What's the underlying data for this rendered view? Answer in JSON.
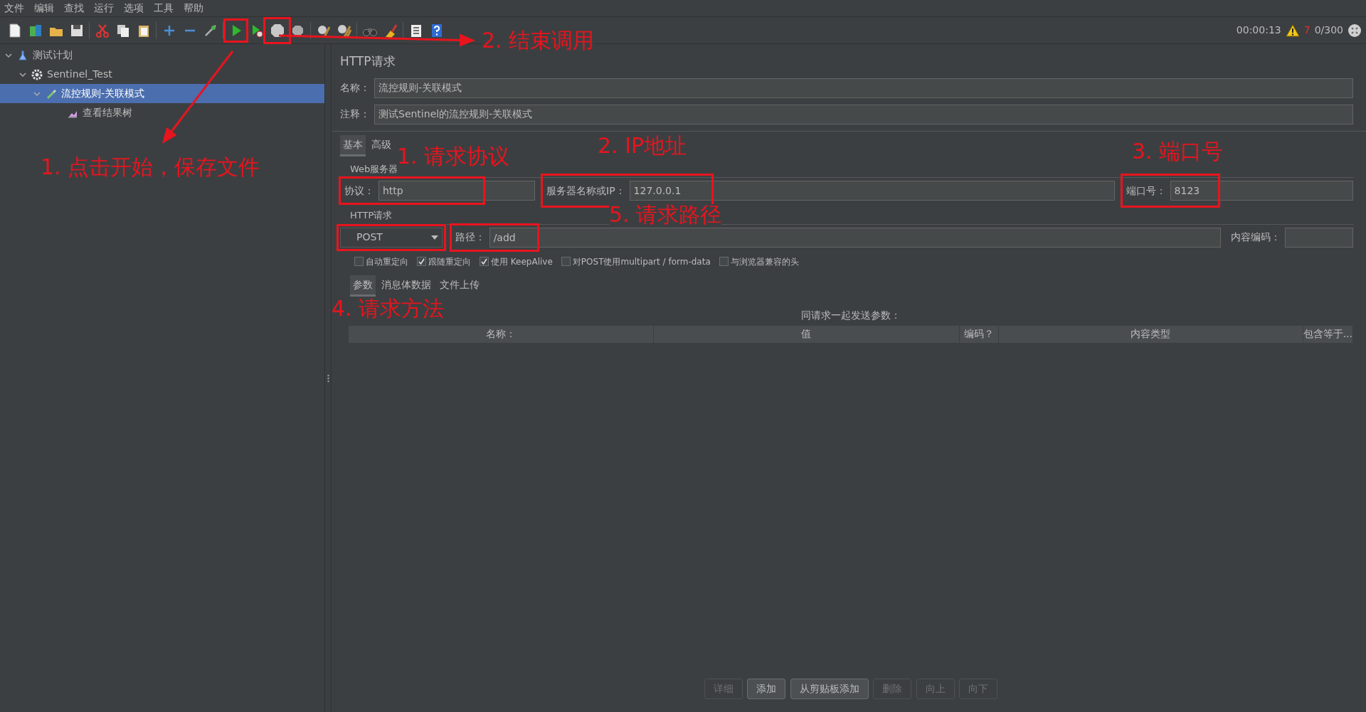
{
  "menu": [
    "文件",
    "编辑",
    "查找",
    "运行",
    "选项",
    "工具",
    "帮助"
  ],
  "status": {
    "elapsed": "00:00:13",
    "warnings": "7",
    "threads": "0/300"
  },
  "tree": [
    {
      "label": "测试计划",
      "kind": "plan",
      "expanded": true,
      "selected": false,
      "children": [
        {
          "label": "Sentinel_Test",
          "kind": "group",
          "expanded": true,
          "selected": false,
          "children": [
            {
              "label": "流控规则-关联模式",
              "kind": "sampler",
              "expanded": true,
              "selected": true,
              "children": [
                {
                  "label": "查看结果树",
                  "kind": "listener",
                  "selected": false
                }
              ]
            }
          ]
        }
      ]
    }
  ],
  "panel": {
    "title": "HTTP请求",
    "name": {
      "label": "名称：",
      "value": "流控规则-关联模式"
    },
    "comment": {
      "label": "注释：",
      "value": "测试Sentinel的流控规则-关联模式"
    },
    "tabs": [
      {
        "label": "基本",
        "selected": true
      },
      {
        "label": "高级",
        "selected": false
      }
    ],
    "web_server": {
      "title": "Web服务器",
      "protocol": {
        "label": "协议：",
        "value": "http"
      },
      "server": {
        "label": "服务器名称或IP：",
        "value": "127.0.0.1"
      },
      "port": {
        "label": "端口号：",
        "value": "8123"
      }
    },
    "http_request": {
      "title": "HTTP请求",
      "method": "POST",
      "path": {
        "label": "路径：",
        "value": "/add"
      },
      "encoding": {
        "label": "内容编码："
      }
    },
    "options": [
      {
        "label": "自动重定向",
        "checked": false
      },
      {
        "label": "跟随重定向",
        "checked": true
      },
      {
        "label": "使用 KeepAlive",
        "checked": true
      },
      {
        "label": "对POST使用multipart / form-data",
        "checked": false
      },
      {
        "label": "与浏览器兼容的头",
        "checked": false
      }
    ],
    "subtabs": [
      {
        "label": "参数",
        "selected": true
      },
      {
        "label": "消息体数据",
        "selected": false
      },
      {
        "label": "文件上传",
        "selected": false
      }
    ],
    "params_caption": "同请求一起发送参数：",
    "columns": [
      "名称：",
      "值",
      "编码？",
      "内容类型",
      "包含等于..."
    ],
    "buttons": [
      {
        "label": "详细",
        "disabled": true
      },
      {
        "label": "添加",
        "disabled": false
      },
      {
        "label": "从剪贴板添加",
        "disabled": false
      },
      {
        "label": "删除",
        "disabled": true
      },
      {
        "label": "向上",
        "disabled": true
      },
      {
        "label": "向下",
        "disabled": true
      }
    ]
  },
  "annotations": [
    "1. 点击开始，保存文件",
    "2. 结束调用",
    "1. 请求协议",
    "2. IP地址",
    "3. 端口号",
    "4. 请求方法",
    "5. 请求路径"
  ]
}
